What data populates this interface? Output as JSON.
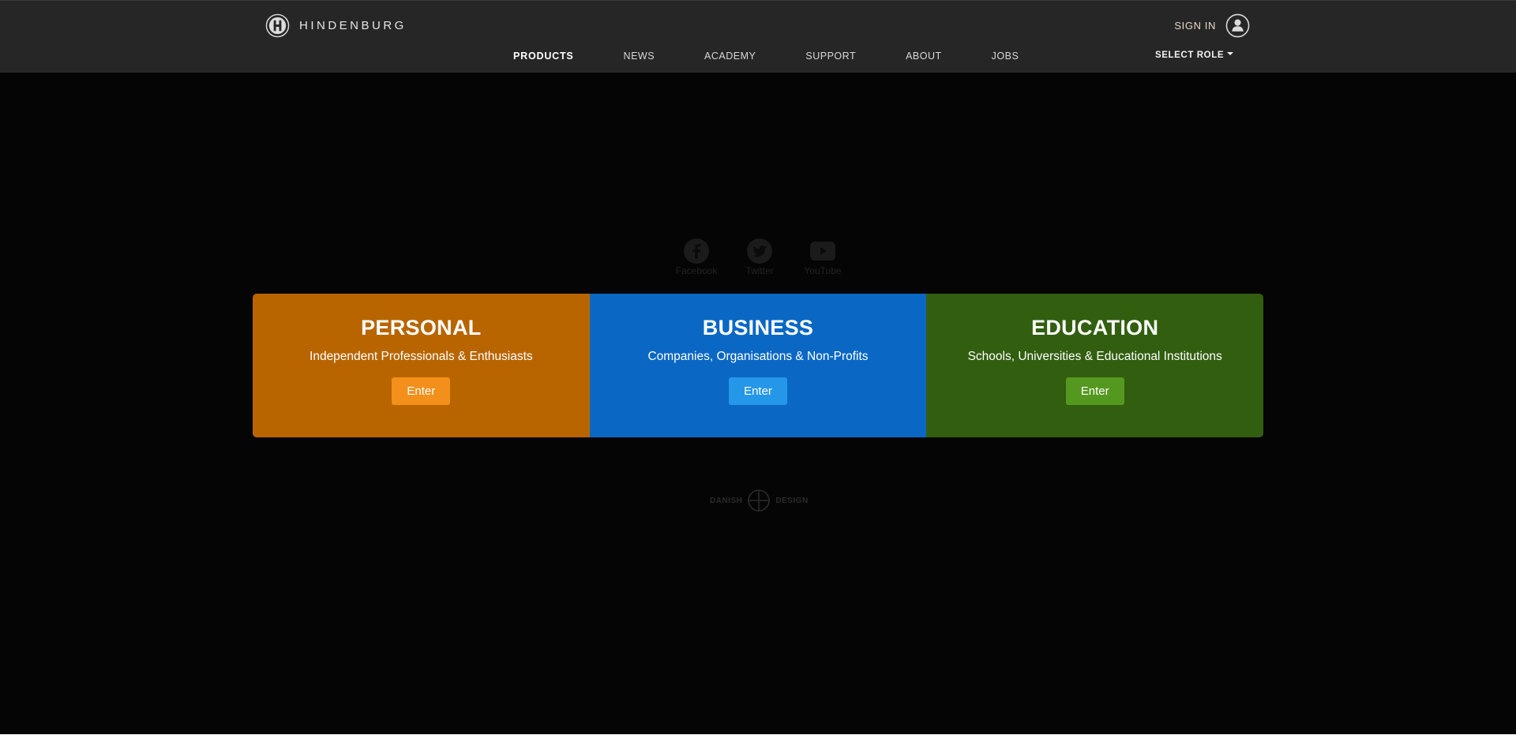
{
  "header": {
    "brand": "HINDENBURG",
    "sign_in": "SIGN IN",
    "nav": [
      "PRODUCTS",
      "NEWS",
      "ACADEMY",
      "SUPPORT",
      "ABOUT",
      "JOBS"
    ],
    "active_nav": "PRODUCTS",
    "select_role": "SELECT ROLE"
  },
  "social": [
    {
      "label": "Facebook",
      "icon": "facebook-icon"
    },
    {
      "label": "Twitter",
      "icon": "twitter-icon"
    },
    {
      "label": "YouTube",
      "icon": "youtube-icon"
    }
  ],
  "cards": [
    {
      "title": "PERSONAL",
      "subtitle": "Independent Professionals & Enthusiasts",
      "button": "Enter",
      "color": "#b86500",
      "button_color": "#f3901b"
    },
    {
      "title": "BUSINESS",
      "subtitle": "Companies, Organisations & Non-Profits",
      "button": "Enter",
      "color": "#0a68c4",
      "button_color": "#2597e8"
    },
    {
      "title": "EDUCATION",
      "subtitle": "Schools, Universities & Educational Institutions",
      "button": "Enter",
      "color": "#325e10",
      "button_color": "#55981f"
    }
  ],
  "footer_badge": {
    "left": "DANISH",
    "right": "DESIGN"
  },
  "colors": {
    "header_bg": "#262626",
    "page_bg": "#050505",
    "sign_in_text": "#e3d6c7"
  }
}
